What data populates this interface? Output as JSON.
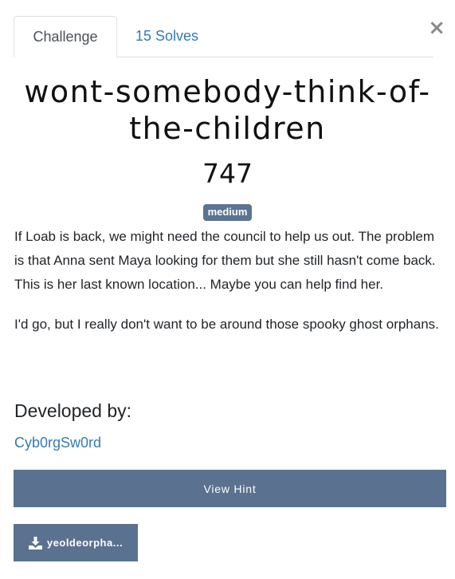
{
  "close": {
    "label": "×"
  },
  "tabs": [
    {
      "label": "Challenge"
    },
    {
      "label": "15 Solves"
    }
  ],
  "challenge": {
    "name": "wont-somebody-think-of-the-children",
    "value": "747",
    "difficulty": "medium",
    "description": [
      "If Loab is back, we might need the council to help us out. The problem is that Anna sent Maya looking for them but she still hasn't come back. This is her last known location... Maybe you can help find her.",
      "I'd go, but I really don't want to be around those spooky ghost orphans."
    ],
    "developed_by_label": "Developed by:",
    "developer": "Cyb0rgSw0rd"
  },
  "buttons": {
    "view_hint": "View Hint",
    "file": "yeoldeorpha..."
  },
  "colors": {
    "accent": "#5b7190",
    "link": "#337ab7",
    "badge": "#5c7392"
  },
  "icons": {
    "close": "close-icon",
    "download": "download-icon"
  }
}
